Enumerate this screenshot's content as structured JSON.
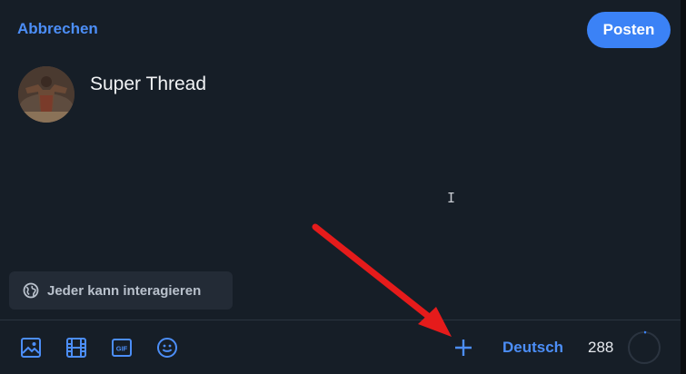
{
  "header": {
    "cancel_label": "Abbrechen",
    "post_label": "Posten"
  },
  "composer": {
    "text": "Super Thread",
    "cursor_glyph": "I"
  },
  "audience": {
    "label": "Jeder kann interagieren",
    "icon": "globe-icon"
  },
  "toolbar": {
    "icons": [
      "image-icon",
      "video-icon",
      "gif-icon",
      "emoji-icon"
    ],
    "add_icon": "plus-icon",
    "language": "Deutsch",
    "remaining_chars": "288",
    "progress_fraction": 0.02
  },
  "colors": {
    "accent": "#3b82f6",
    "link": "#4c8ef7",
    "background": "#161e27",
    "annotation_arrow": "#e51b1b"
  }
}
